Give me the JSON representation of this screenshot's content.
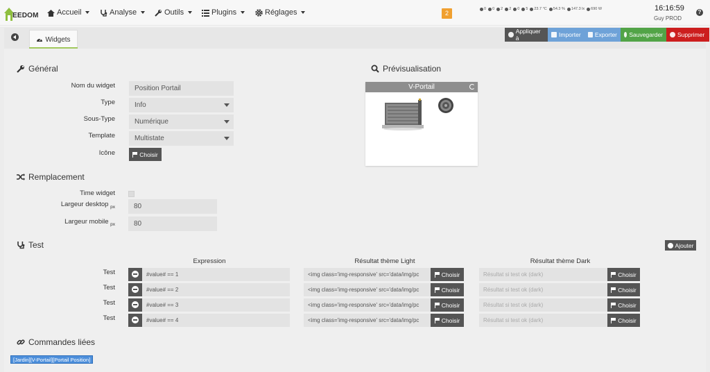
{
  "brand": {
    "logo_text": "EEDOM"
  },
  "nav": [
    {
      "label": "Accueil",
      "icon": "home-icon"
    },
    {
      "label": "Analyse",
      "icon": "stethoscope-icon"
    },
    {
      "label": "Outils",
      "icon": "wrench-icon"
    },
    {
      "label": "Plugins",
      "icon": "list-icon"
    },
    {
      "label": "Réglages",
      "icon": "gear-icon"
    }
  ],
  "notification_count": "2",
  "status": [
    {
      "icon": "light-icon",
      "value": "0"
    },
    {
      "icon": "motion-icon",
      "value": "0"
    },
    {
      "icon": "window-icon",
      "value": "2"
    },
    {
      "icon": "shutter-icon",
      "value": "2"
    },
    {
      "icon": "bulb-icon",
      "value": "0"
    },
    {
      "icon": "plug-icon",
      "value": "5"
    },
    {
      "icon": "thermometer-icon",
      "value": "23.7 °C"
    },
    {
      "icon": "humidity-icon",
      "value": "54.3 %"
    },
    {
      "icon": "luminosity-icon",
      "value": "147.3 lx"
    },
    {
      "icon": "power-icon",
      "value": "690 W"
    }
  ],
  "clock": "16:16:59",
  "user": "Guy PROD",
  "tab_label": "Widgets",
  "actions": {
    "apply": "Appliquer à",
    "import": "Importer",
    "export": "Exporter",
    "save": "Sauvegarder",
    "delete": "Supprimer"
  },
  "general": {
    "title": "Général",
    "name_label": "Nom du widget",
    "name_value": "Position Portail",
    "type_label": "Type",
    "type_value": "Info",
    "subtype_label": "Sous-Type",
    "subtype_value": "Numérique",
    "template_label": "Template",
    "template_value": "Multistate",
    "icon_label": "Icône",
    "icon_button": "Choisir"
  },
  "preview": {
    "title": "Prévisualisation",
    "widget_name": "V-Portail"
  },
  "replacement": {
    "title": "Remplacement",
    "time_widget_label": "Time widget",
    "desktop_label": "Largeur desktop",
    "desktop_unit": "px",
    "desktop_value": "80",
    "mobile_label": "Largeur mobile",
    "mobile_unit": "px",
    "mobile_value": "80"
  },
  "test": {
    "title": "Test",
    "add_button": "Ajouter",
    "col_expression": "Expression",
    "col_light": "Résultat thème Light",
    "col_dark": "Résultat thème Dark",
    "choose": "Choisir",
    "rows": [
      {
        "label": "Test",
        "expression": "#value#  == 1",
        "light": "<img class='img-responsive' src='data/img/pc",
        "dark": "Résultat si test ok (dark)"
      },
      {
        "label": "Test",
        "expression": "#value#  == 2",
        "light": "<img class='img-responsive' src='data/img/pc",
        "dark": "Résultat si test ok (dark)"
      },
      {
        "label": "Test",
        "expression": "#value#  == 3",
        "light": "<img class='img-responsive' src='data/img/pc",
        "dark": "Résultat si test ok (dark)"
      },
      {
        "label": "Test",
        "expression": "#value#  == 4",
        "light": "<img class='img-responsive' src='data/img/pc",
        "dark": "Résultat si test ok (dark)"
      }
    ]
  },
  "linked": {
    "title": "Commandes liées",
    "command": "[Jardin][V-Portail][Portail Position]"
  }
}
